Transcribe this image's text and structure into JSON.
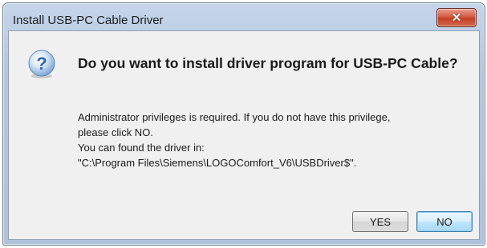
{
  "window": {
    "title": "Install USB-PC Cable Driver",
    "close_icon": "close-icon"
  },
  "message": {
    "icon": "question-icon",
    "headline": "Do you want to install driver program for USB-PC Cable?",
    "lines": [
      "Administrator privileges is required. If you do not have this privilege,",
      "please click NO.",
      "You can found the driver in:",
      "\"C:\\Program Files\\Siemens\\LOGOComfort_V6\\USBDriver$\"."
    ]
  },
  "buttons": {
    "yes_label": "YES",
    "no_label": "NO"
  },
  "colors": {
    "accent": "#3c7fb1",
    "close": "#c23e22",
    "icon": "#2d67b7"
  }
}
